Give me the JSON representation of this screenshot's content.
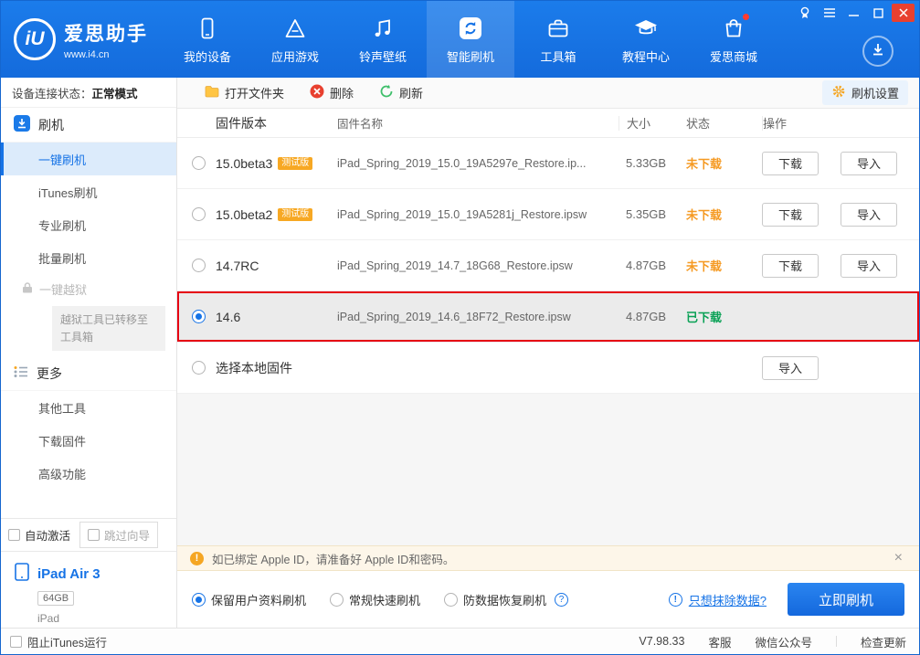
{
  "header": {
    "logo": {
      "mark": "iU",
      "title": "爱思助手",
      "subtitle": "www.i4.cn"
    },
    "nav": [
      {
        "label": "我的设备"
      },
      {
        "label": "应用游戏"
      },
      {
        "label": "铃声壁纸"
      },
      {
        "label": "智能刷机"
      },
      {
        "label": "工具箱"
      },
      {
        "label": "教程中心"
      },
      {
        "label": "爱思商城"
      }
    ]
  },
  "toolbar": {
    "open_folder": "打开文件夹",
    "delete": "删除",
    "refresh": "刷新",
    "settings": "刷机设置"
  },
  "sidebar": {
    "connection_label": "设备连接状态：",
    "connection_value": "正常模式",
    "section_flash": "刷机",
    "items_flash": [
      "一键刷机",
      "iTunes刷机",
      "专业刷机",
      "批量刷机"
    ],
    "jailbreak": "一键越狱",
    "jailbreak_note": "越狱工具已转移至工具箱",
    "section_more": "更多",
    "items_more": [
      "其他工具",
      "下载固件",
      "高级功能"
    ],
    "auto_activate": "自动激活",
    "skip_wizard": "跳过向导",
    "device": {
      "name": "iPad Air 3",
      "capacity": "64GB",
      "model": "iPad"
    }
  },
  "table": {
    "headers": {
      "version": "固件版本",
      "name": "固件名称",
      "size": "大小",
      "status": "状态",
      "action": "操作"
    },
    "beta_badge": "测试版",
    "download_label": "下载",
    "import_label": "导入",
    "rows": [
      {
        "version": "15.0beta3",
        "name": "iPad_Spring_2019_15.0_19A5297e_Restore.ip...",
        "size": "5.33GB",
        "status": "未下载"
      },
      {
        "version": "15.0beta2",
        "name": "iPad_Spring_2019_15.0_19A5281j_Restore.ipsw",
        "size": "5.35GB",
        "status": "未下载"
      },
      {
        "version": "14.7RC",
        "name": "iPad_Spring_2019_14.7_18G68_Restore.ipsw",
        "size": "4.87GB",
        "status": "未下载"
      },
      {
        "version": "14.6",
        "name": "iPad_Spring_2019_14.6_18F72_Restore.ipsw",
        "size": "4.87GB",
        "status": "已下载"
      },
      {
        "version": "选择本地固件"
      }
    ]
  },
  "notice": {
    "text": "如已绑定 Apple ID，请准备好 Apple ID和密码。"
  },
  "options": {
    "radios": [
      "保留用户资料刷机",
      "常规快速刷机",
      "防数据恢复刷机"
    ],
    "erase_link": "只想抹除数据?",
    "flash_button": "立即刷机"
  },
  "statusbar": {
    "block_itunes": "阻止iTunes运行",
    "version": "V7.98.33",
    "service": "客服",
    "wechat": "微信公众号",
    "check_update": "检查更新"
  },
  "colors": {
    "primary_blue": "#1673E6",
    "status_pending_orange": "#F59A23",
    "status_done_green": "#09A155",
    "selected_row_border_red": "#E60012",
    "beta_badge_orange": "#F7A823"
  }
}
